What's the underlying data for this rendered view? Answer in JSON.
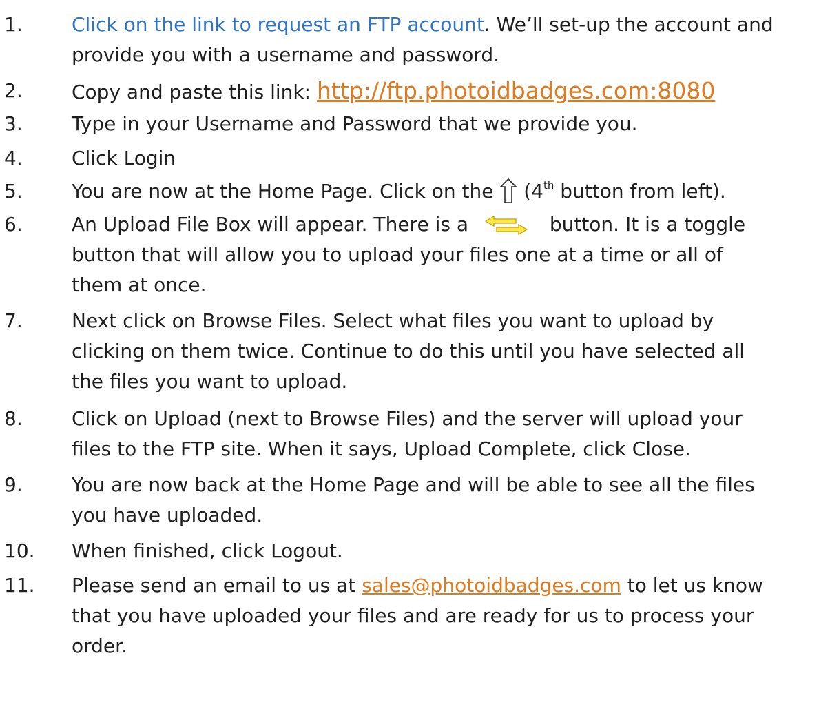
{
  "steps": [
    {
      "num": "1.",
      "link": "Click on the link to request an FTP account",
      "text_after": ". We’ll set-up the account and",
      "line2": "provide you with a username and password."
    },
    {
      "num": "2.",
      "text": "Copy and paste this link: ",
      "link": "http://ftp.photoidbadges.com:8080"
    },
    {
      "num": "3.",
      "text": "Type in your Username and Password that we provide you."
    },
    {
      "num": "4.",
      "text": "Click Login"
    },
    {
      "num": "5.",
      "text_before": "You are now at the Home Page.  Click on the ",
      "text_after_open": " (4",
      "sup": "th",
      "text_after_close": " button from left).",
      "icon": "up-arrow-icon"
    },
    {
      "num": "6.",
      "text_before": "An Upload File Box will appear.  There is a ",
      "text_after": " button.  It is a toggle",
      "line2": "button that will allow you to upload your files one at a time or all of",
      "line3": "them at once.",
      "icon": "toggle-arrows-icon"
    },
    {
      "num": "7.",
      "line1": "Next click on Browse Files.  Select what files you want to upload by",
      "line2": "clicking on them twice.  Continue to do this until you have selected all",
      "line3": "the files you want to upload."
    },
    {
      "num": "8.",
      "line1": "Click on Upload (next to Browse Files) and the server will upload your",
      "line2": "files to the FTP site. When it says, Upload Complete, click Close."
    },
    {
      "num": "9.",
      "line1": "You are now back at the Home Page and will be able to see all the files",
      "line2": "you have uploaded."
    },
    {
      "num": "10.",
      "text": "When finished, click Logout."
    },
    {
      "num": "11.",
      "text_before": "Please send an email to us at ",
      "link": "sales@photoidbadges.com",
      "text_after": " to let us know",
      "line2": "that you have uploaded your files and are ready for us to process your",
      "line3": "order."
    }
  ],
  "colors": {
    "text": "#1f1f1f",
    "link_blue": "#2f73c2",
    "link_orange": "#e07a1f",
    "arrow_yellow": "#ffe94a",
    "arrow_outline": "#c9a000"
  }
}
